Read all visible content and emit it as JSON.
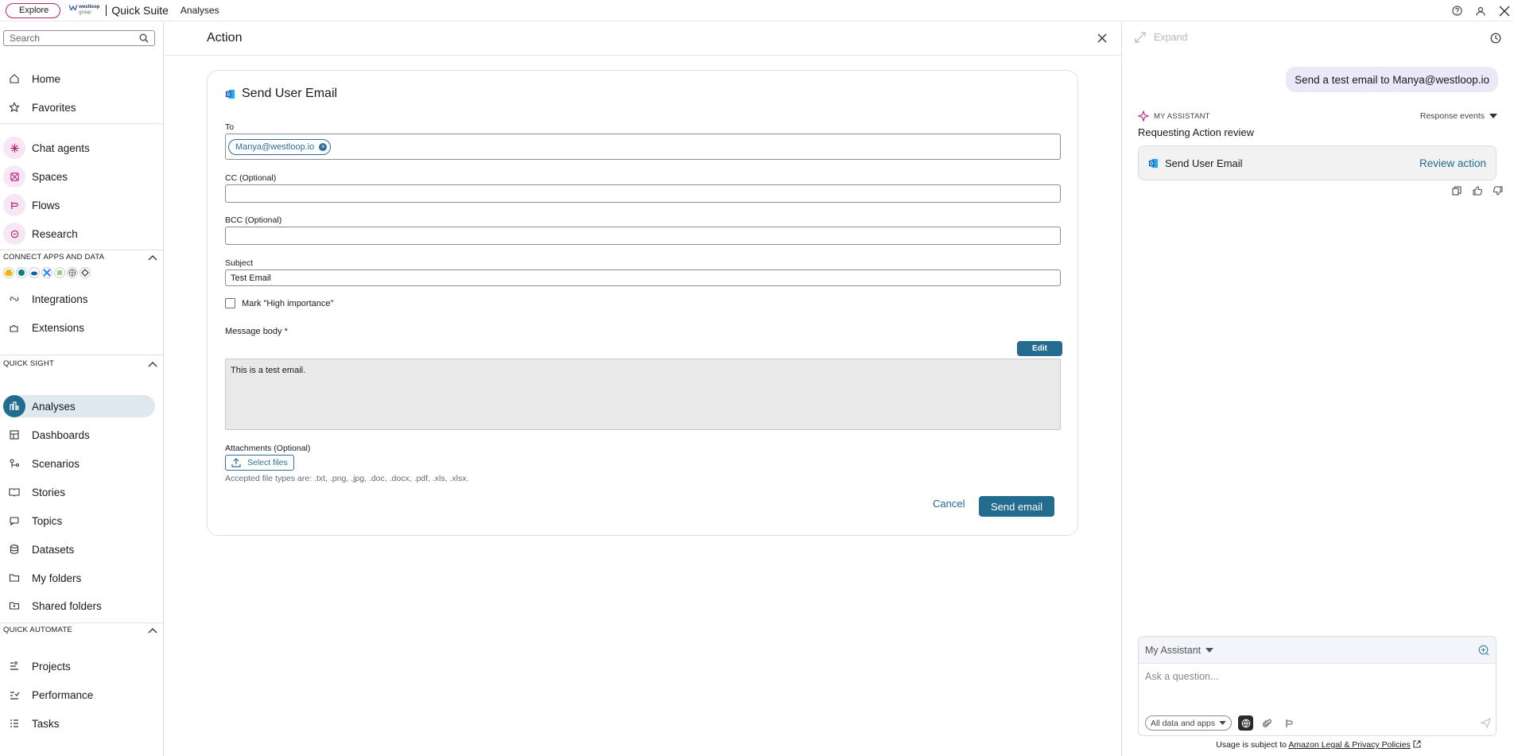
{
  "topbar": {
    "explore_label": "Explore",
    "brand_logo_text": "westloop",
    "brand_logo_sub": "group",
    "app_name": "Quick Suite",
    "section": "Analyses"
  },
  "sidebar": {
    "search_placeholder": "Search",
    "primary": [
      {
        "label": "Home",
        "icon": "home-icon"
      },
      {
        "label": "Favorites",
        "icon": "star-icon"
      }
    ],
    "agents": [
      {
        "label": "Chat agents",
        "icon": "sparkle-icon"
      },
      {
        "label": "Spaces",
        "icon": "spaces-icon"
      },
      {
        "label": "Flows",
        "icon": "flows-icon"
      },
      {
        "label": "Research",
        "icon": "research-icon"
      }
    ],
    "connect_heading": "CONNECT APPS AND DATA",
    "connect_items": [
      {
        "label": "Integrations",
        "icon": "integrations-icon"
      },
      {
        "label": "Extensions",
        "icon": "extensions-icon"
      }
    ],
    "quicksight_heading": "QUICK SIGHT",
    "quicksight_items": [
      {
        "label": "Analyses",
        "icon": "analyses-icon"
      },
      {
        "label": "Dashboards",
        "icon": "dashboards-icon"
      },
      {
        "label": "Scenarios",
        "icon": "scenarios-icon"
      },
      {
        "label": "Stories",
        "icon": "stories-icon"
      },
      {
        "label": "Topics",
        "icon": "topics-icon"
      },
      {
        "label": "Datasets",
        "icon": "datasets-icon"
      },
      {
        "label": "My folders",
        "icon": "folder-icon"
      },
      {
        "label": "Shared folders",
        "icon": "shared-folder-icon"
      }
    ],
    "automate_heading": "QUICK AUTOMATE",
    "automate_items": [
      {
        "label": "Projects",
        "icon": "projects-icon"
      },
      {
        "label": "Performance",
        "icon": "performance-icon"
      },
      {
        "label": "Tasks",
        "icon": "tasks-icon"
      }
    ]
  },
  "action": {
    "panel_title": "Action",
    "card_title": "Send User Email",
    "to_label": "To",
    "to_recipient": "Manya@westloop.io",
    "cc_label": "CC (Optional)",
    "cc_value": "",
    "bcc_label": "BCC (Optional)",
    "bcc_value": "",
    "subject_label": "Subject",
    "subject_value": "Test Email",
    "high_importance_label": "Mark \"High importance\"",
    "message_label": "Message body *",
    "edit_label": "Edit",
    "message_value": "This is a test email.",
    "attachments_label": "Attachments (Optional)",
    "select_files_label": "Select files",
    "accepted_types": "Accepted file types are: .txt, .png, .jpg, .doc, .docx, .pdf, .xls, .xlsx.",
    "cancel_label": "Cancel",
    "send_label": "Send email"
  },
  "assistant": {
    "expand_label": "Expand",
    "user_message": "Send a test email to Manya@westloop.io",
    "assistant_label": "MY ASSISTANT",
    "response_events": "Response events",
    "requesting": "Requesting Action review",
    "action_name": "Send User Email",
    "review_label": "Review action",
    "selector": "My Assistant",
    "ask_placeholder": "Ask a question...",
    "scope": "All data and apps",
    "legal_prefix": "Usage is subject to",
    "legal_link": "Amazon Legal & Privacy Policies"
  },
  "colors": {
    "accent": "#236b8f",
    "brand_pink": "#b4247a",
    "active_bg": "#dde9ef",
    "user_bubble": "#ebe9f8"
  }
}
